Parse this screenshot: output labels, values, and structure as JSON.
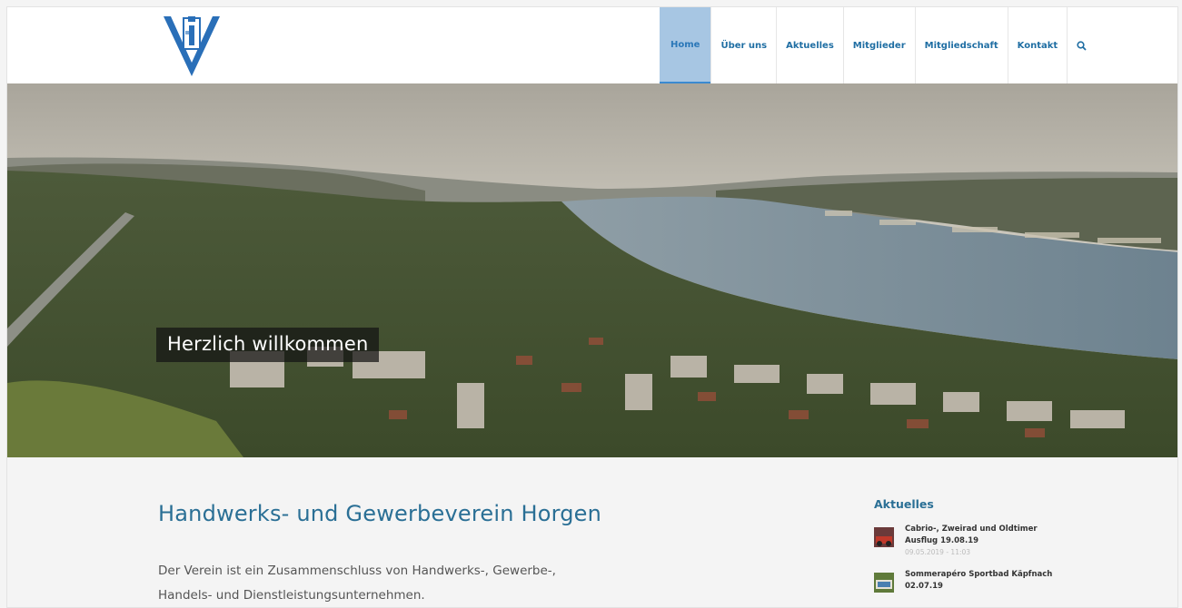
{
  "nav": {
    "items": [
      {
        "label": "Home",
        "active": true
      },
      {
        "label": "Über uns",
        "active": false
      },
      {
        "label": "Aktuelles",
        "active": false
      },
      {
        "label": "Mitglieder",
        "active": false
      },
      {
        "label": "Mitgliedschaft",
        "active": false
      },
      {
        "label": "Kontakt",
        "active": false
      }
    ],
    "search_icon": "search-icon",
    "accent_color": "#1f6ea3",
    "active_bg": "#a7c6e3"
  },
  "logo": {
    "icon": "hgv-logo"
  },
  "hero": {
    "caption": "Herzlich willkommen"
  },
  "main": {
    "title": "Handwerks- und Gewerbeverein Horgen",
    "intro_line1": "Der Verein ist ein Zusammenschluss von Handwerks-, Gewerbe-,",
    "intro_line2": "Handels- und Dienstleistungsunternehmen."
  },
  "sidebar": {
    "title": "Aktuelles",
    "news": [
      {
        "title_line1": "Cabrio-, Zweirad und Oldtimer",
        "title_line2": "Ausflug 19.08.19",
        "date": "09.05.2019 - 11:03"
      },
      {
        "title_line1": "Sommerapéro Sportbad Käpfnach",
        "title_line2": "02.07.19",
        "date": ""
      }
    ]
  }
}
